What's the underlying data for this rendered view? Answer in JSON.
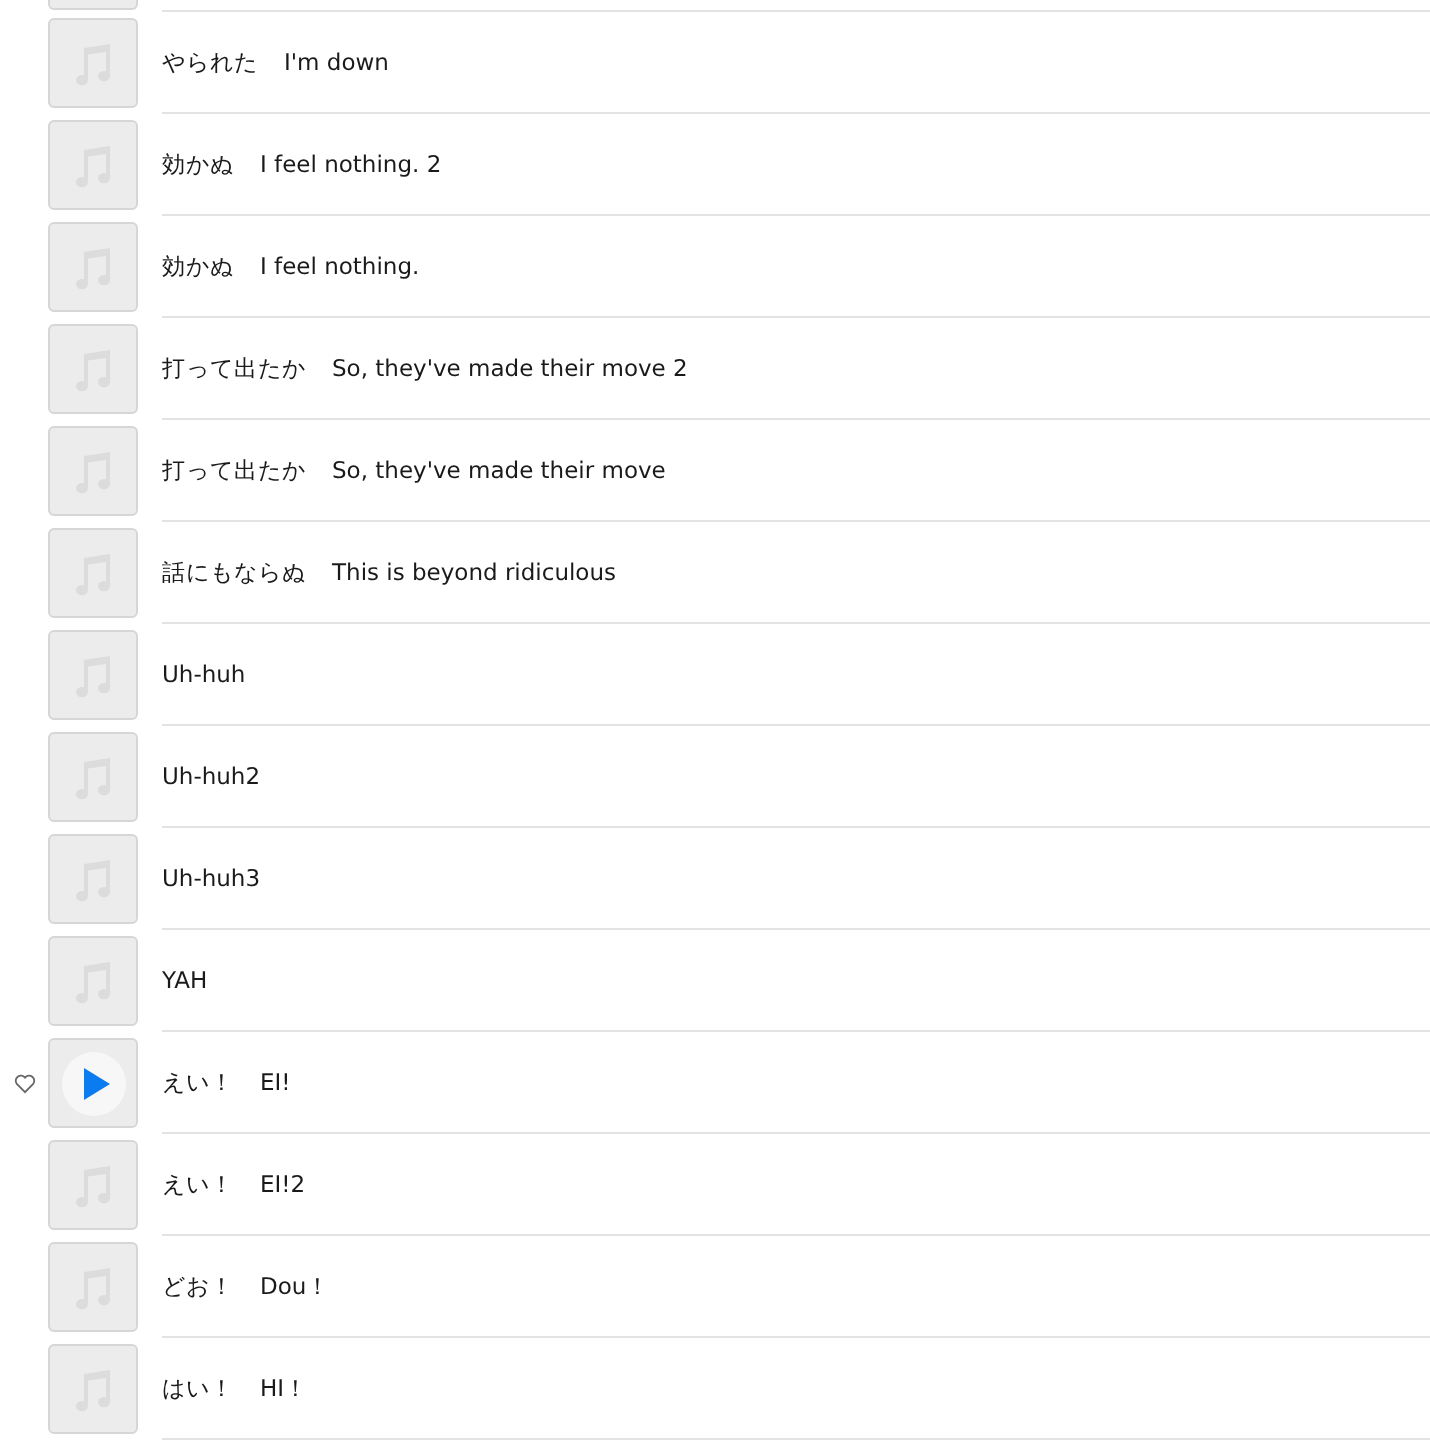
{
  "tracks": [
    {
      "parts": [
        "やられた",
        "I'm down"
      ],
      "playing": false
    },
    {
      "parts": [
        "効かぬ",
        "I feel nothing. 2"
      ],
      "playing": false
    },
    {
      "parts": [
        "効かぬ",
        "I feel nothing."
      ],
      "playing": false
    },
    {
      "parts": [
        "打って出たか",
        "So, they've made their move 2"
      ],
      "playing": false
    },
    {
      "parts": [
        "打って出たか",
        "So, they've made their move"
      ],
      "playing": false
    },
    {
      "parts": [
        "話にもならぬ",
        "This is beyond ridiculous"
      ],
      "playing": false
    },
    {
      "parts": [
        "Uh-huh"
      ],
      "playing": false
    },
    {
      "parts": [
        "Uh-huh2"
      ],
      "playing": false
    },
    {
      "parts": [
        "Uh-huh3"
      ],
      "playing": false
    },
    {
      "parts": [
        "YAH"
      ],
      "playing": false
    },
    {
      "parts": [
        "えい！",
        "EI!"
      ],
      "playing": true
    },
    {
      "parts": [
        "えい！",
        "EI!2"
      ],
      "playing": false
    },
    {
      "parts": [
        "どお！",
        "Dou！"
      ],
      "playing": false
    },
    {
      "parts": [
        "はい！",
        "HI！"
      ],
      "playing": false
    }
  ]
}
